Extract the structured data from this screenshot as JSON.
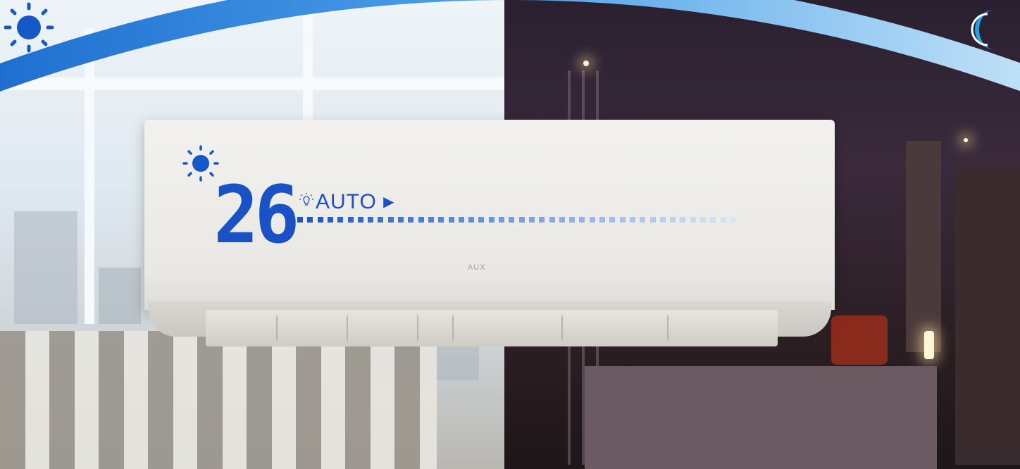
{
  "display": {
    "temperature": "26",
    "mode_label": "AUTO",
    "mode_arrow": "▶",
    "light_icon": "lightbulb-icon"
  },
  "brand": "AUX",
  "icons": {
    "day": "sun-icon",
    "night": "moon-icon",
    "display_day": "sun-icon"
  },
  "colors": {
    "accent": "#1a52c6",
    "arc": "#3a8fe0"
  }
}
